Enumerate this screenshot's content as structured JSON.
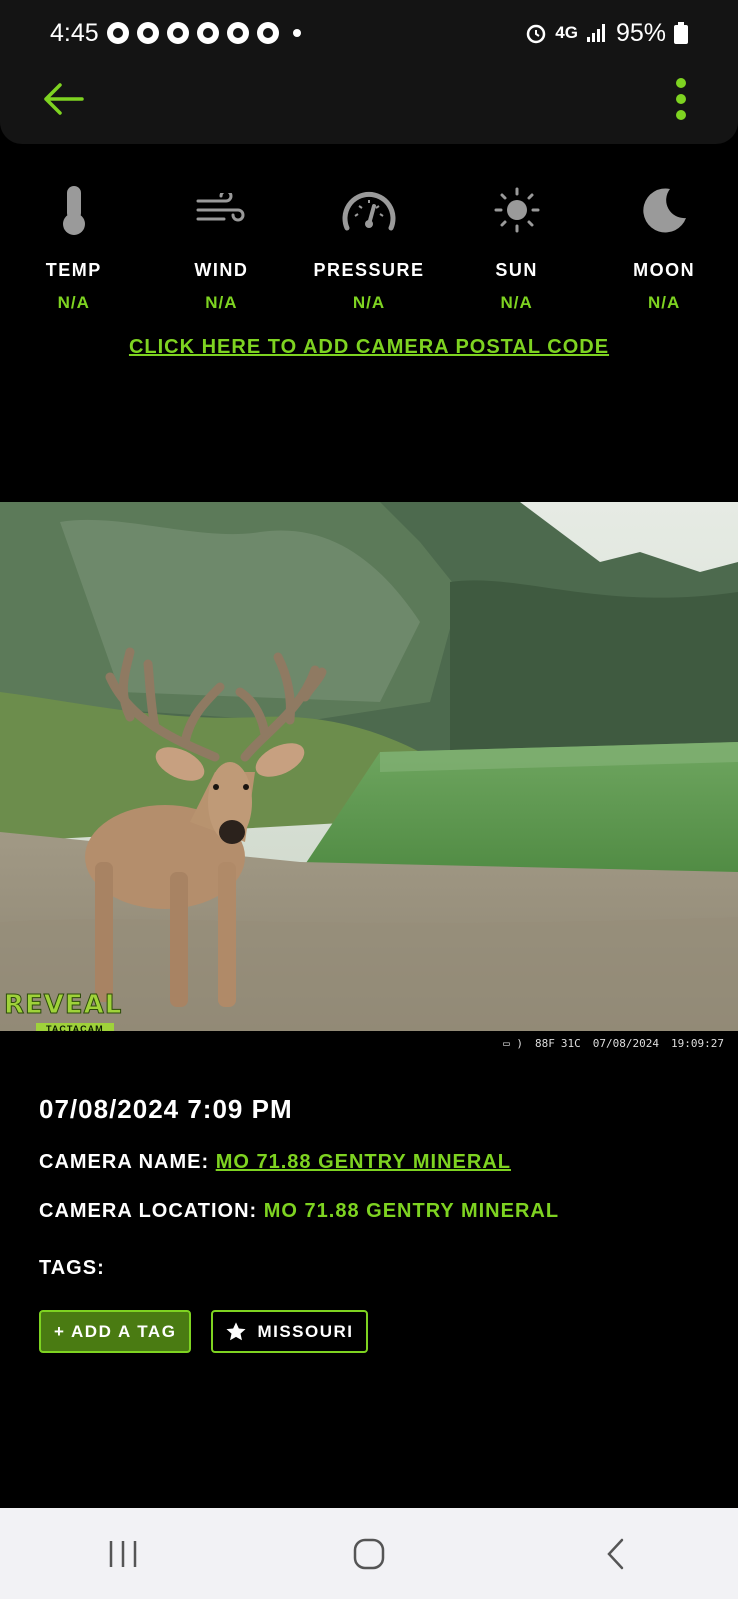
{
  "status_bar": {
    "time": "4:45",
    "network": "4G",
    "battery": "95%"
  },
  "header": {
    "back_icon": "arrow-left-icon",
    "menu_icon": "more-vertical-icon"
  },
  "weather": {
    "items": [
      {
        "label": "TEMP",
        "value": "N/A",
        "icon": "thermometer-icon"
      },
      {
        "label": "WIND",
        "value": "N/A",
        "icon": "wind-icon"
      },
      {
        "label": "PRESSURE",
        "value": "N/A",
        "icon": "gauge-icon"
      },
      {
        "label": "SUN",
        "value": "N/A",
        "icon": "sun-icon"
      },
      {
        "label": "MOON",
        "value": "N/A",
        "icon": "moon-icon"
      }
    ],
    "postal_link": "CLICK HERE TO ADD CAMERA POSTAL CODE"
  },
  "photo": {
    "logo_main": "REVEAL",
    "logo_sub": "TACTACAM",
    "stamp": {
      "temp_f": "88F",
      "temp_c": "31C",
      "date": "07/08/2024",
      "time": "19:09:27"
    }
  },
  "details": {
    "datetime": "07/08/2024 7:09 PM",
    "camera_name_label": "CAMERA NAME:",
    "camera_name_value": "MO 71.88 GENTRY MINERAL",
    "camera_location_label": "CAMERA LOCATION:",
    "camera_location_value": "MO 71.88 GENTRY MINERAL",
    "tags_label": "TAGS:",
    "add_tag_label": "+ ADD A TAG",
    "tags": [
      {
        "label": "MISSOURI",
        "icon": "star-icon"
      }
    ]
  },
  "colors": {
    "accent": "#7ED321",
    "background": "#000000",
    "header": "#141414"
  }
}
